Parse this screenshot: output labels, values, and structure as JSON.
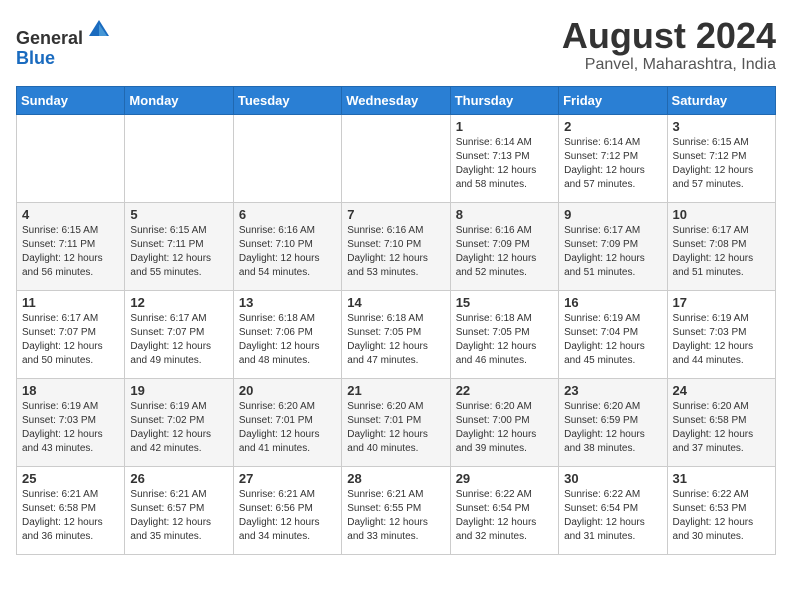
{
  "header": {
    "logo_line1": "General",
    "logo_line2": "Blue",
    "month_year": "August 2024",
    "location": "Panvel, Maharashtra, India"
  },
  "weekdays": [
    "Sunday",
    "Monday",
    "Tuesday",
    "Wednesday",
    "Thursday",
    "Friday",
    "Saturday"
  ],
  "weeks": [
    [
      {
        "day": "",
        "info": ""
      },
      {
        "day": "",
        "info": ""
      },
      {
        "day": "",
        "info": ""
      },
      {
        "day": "",
        "info": ""
      },
      {
        "day": "1",
        "info": "Sunrise: 6:14 AM\nSunset: 7:13 PM\nDaylight: 12 hours\nand 58 minutes."
      },
      {
        "day": "2",
        "info": "Sunrise: 6:14 AM\nSunset: 7:12 PM\nDaylight: 12 hours\nand 57 minutes."
      },
      {
        "day": "3",
        "info": "Sunrise: 6:15 AM\nSunset: 7:12 PM\nDaylight: 12 hours\nand 57 minutes."
      }
    ],
    [
      {
        "day": "4",
        "info": "Sunrise: 6:15 AM\nSunset: 7:11 PM\nDaylight: 12 hours\nand 56 minutes."
      },
      {
        "day": "5",
        "info": "Sunrise: 6:15 AM\nSunset: 7:11 PM\nDaylight: 12 hours\nand 55 minutes."
      },
      {
        "day": "6",
        "info": "Sunrise: 6:16 AM\nSunset: 7:10 PM\nDaylight: 12 hours\nand 54 minutes."
      },
      {
        "day": "7",
        "info": "Sunrise: 6:16 AM\nSunset: 7:10 PM\nDaylight: 12 hours\nand 53 minutes."
      },
      {
        "day": "8",
        "info": "Sunrise: 6:16 AM\nSunset: 7:09 PM\nDaylight: 12 hours\nand 52 minutes."
      },
      {
        "day": "9",
        "info": "Sunrise: 6:17 AM\nSunset: 7:09 PM\nDaylight: 12 hours\nand 51 minutes."
      },
      {
        "day": "10",
        "info": "Sunrise: 6:17 AM\nSunset: 7:08 PM\nDaylight: 12 hours\nand 51 minutes."
      }
    ],
    [
      {
        "day": "11",
        "info": "Sunrise: 6:17 AM\nSunset: 7:07 PM\nDaylight: 12 hours\nand 50 minutes."
      },
      {
        "day": "12",
        "info": "Sunrise: 6:17 AM\nSunset: 7:07 PM\nDaylight: 12 hours\nand 49 minutes."
      },
      {
        "day": "13",
        "info": "Sunrise: 6:18 AM\nSunset: 7:06 PM\nDaylight: 12 hours\nand 48 minutes."
      },
      {
        "day": "14",
        "info": "Sunrise: 6:18 AM\nSunset: 7:05 PM\nDaylight: 12 hours\nand 47 minutes."
      },
      {
        "day": "15",
        "info": "Sunrise: 6:18 AM\nSunset: 7:05 PM\nDaylight: 12 hours\nand 46 minutes."
      },
      {
        "day": "16",
        "info": "Sunrise: 6:19 AM\nSunset: 7:04 PM\nDaylight: 12 hours\nand 45 minutes."
      },
      {
        "day": "17",
        "info": "Sunrise: 6:19 AM\nSunset: 7:03 PM\nDaylight: 12 hours\nand 44 minutes."
      }
    ],
    [
      {
        "day": "18",
        "info": "Sunrise: 6:19 AM\nSunset: 7:03 PM\nDaylight: 12 hours\nand 43 minutes."
      },
      {
        "day": "19",
        "info": "Sunrise: 6:19 AM\nSunset: 7:02 PM\nDaylight: 12 hours\nand 42 minutes."
      },
      {
        "day": "20",
        "info": "Sunrise: 6:20 AM\nSunset: 7:01 PM\nDaylight: 12 hours\nand 41 minutes."
      },
      {
        "day": "21",
        "info": "Sunrise: 6:20 AM\nSunset: 7:01 PM\nDaylight: 12 hours\nand 40 minutes."
      },
      {
        "day": "22",
        "info": "Sunrise: 6:20 AM\nSunset: 7:00 PM\nDaylight: 12 hours\nand 39 minutes."
      },
      {
        "day": "23",
        "info": "Sunrise: 6:20 AM\nSunset: 6:59 PM\nDaylight: 12 hours\nand 38 minutes."
      },
      {
        "day": "24",
        "info": "Sunrise: 6:20 AM\nSunset: 6:58 PM\nDaylight: 12 hours\nand 37 minutes."
      }
    ],
    [
      {
        "day": "25",
        "info": "Sunrise: 6:21 AM\nSunset: 6:58 PM\nDaylight: 12 hours\nand 36 minutes."
      },
      {
        "day": "26",
        "info": "Sunrise: 6:21 AM\nSunset: 6:57 PM\nDaylight: 12 hours\nand 35 minutes."
      },
      {
        "day": "27",
        "info": "Sunrise: 6:21 AM\nSunset: 6:56 PM\nDaylight: 12 hours\nand 34 minutes."
      },
      {
        "day": "28",
        "info": "Sunrise: 6:21 AM\nSunset: 6:55 PM\nDaylight: 12 hours\nand 33 minutes."
      },
      {
        "day": "29",
        "info": "Sunrise: 6:22 AM\nSunset: 6:54 PM\nDaylight: 12 hours\nand 32 minutes."
      },
      {
        "day": "30",
        "info": "Sunrise: 6:22 AM\nSunset: 6:54 PM\nDaylight: 12 hours\nand 31 minutes."
      },
      {
        "day": "31",
        "info": "Sunrise: 6:22 AM\nSunset: 6:53 PM\nDaylight: 12 hours\nand 30 minutes."
      }
    ]
  ]
}
